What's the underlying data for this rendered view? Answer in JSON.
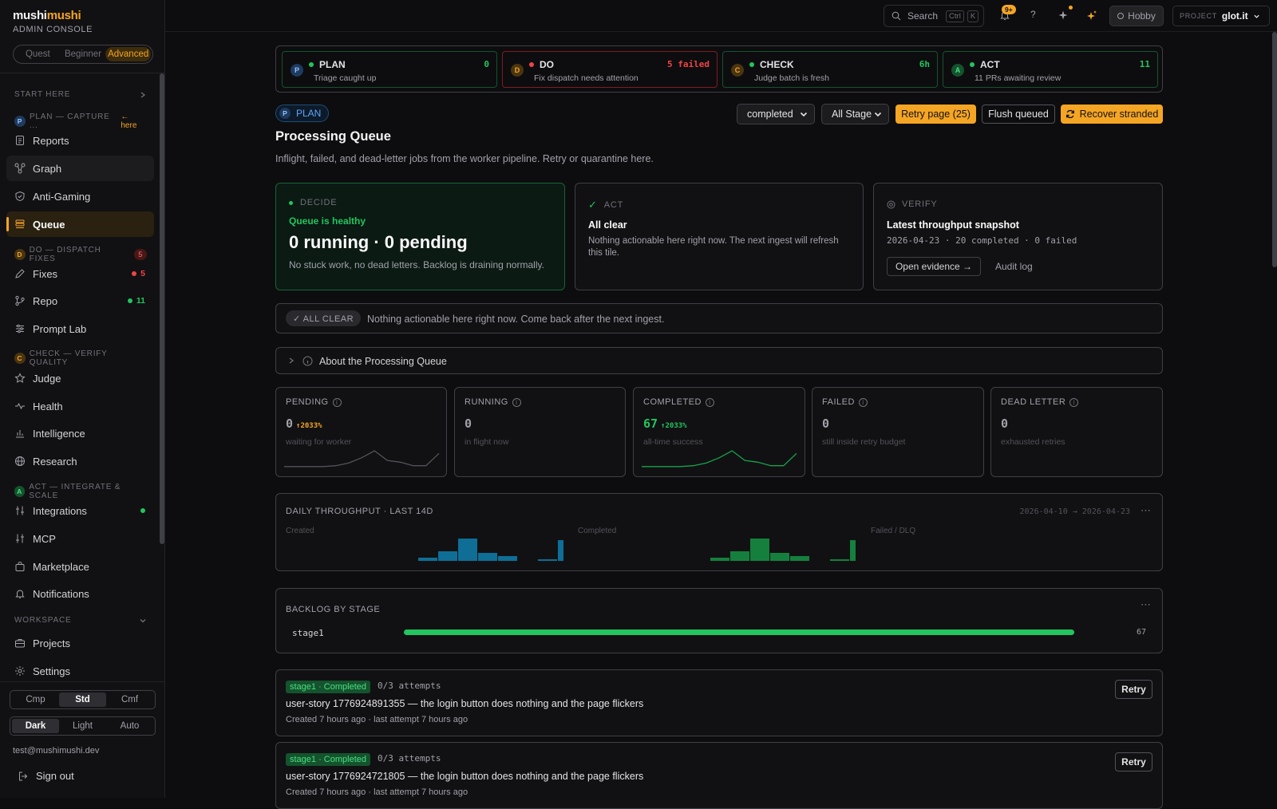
{
  "brand": {
    "prefix": "mushi",
    "accent": "mushi",
    "subtitle": "ADMIN CONSOLE"
  },
  "modes": [
    {
      "label": "Quest",
      "active": false
    },
    {
      "label": "Beginner",
      "active": false
    },
    {
      "label": "Advanced",
      "active": true
    }
  ],
  "sidebar": {
    "start_here": "START HERE",
    "plan_section": {
      "badge": "P",
      "label": "PLAN — CAPTURE ...",
      "here": "← here"
    },
    "do_section": {
      "badge": "D",
      "label": "DO — DISPATCH FIXES",
      "count": "5"
    },
    "check_section": {
      "badge": "C",
      "label": "CHECK — VERIFY QUALITY"
    },
    "act_section": {
      "badge": "A",
      "label": "ACT — INTEGRATE & SCALE"
    },
    "workspace": "WORKSPACE",
    "items": {
      "reports": "Reports",
      "graph": "Graph",
      "anti_gaming": "Anti-Gaming",
      "queue": "Queue",
      "fixes": "Fixes",
      "fixes_count": "5",
      "repo": "Repo",
      "repo_count": "11",
      "prompt_lab": "Prompt Lab",
      "judge": "Judge",
      "health": "Health",
      "intelligence": "Intelligence",
      "research": "Research",
      "integrations": "Integrations",
      "mcp": "MCP",
      "marketplace": "Marketplace",
      "notifications": "Notifications",
      "projects": "Projects",
      "settings": "Settings"
    },
    "density": [
      "Cmp",
      "Std",
      "Cmf"
    ],
    "theme": [
      "Dark",
      "Light",
      "Auto"
    ],
    "email": "test@mushimushi.dev",
    "sign_out": "Sign out"
  },
  "topbar": {
    "search": "Search",
    "kbd_ctrl": "Ctrl",
    "kbd_k": "K",
    "notif_badge": "9+",
    "help": "?",
    "plan": "Hobby",
    "project_label": "PROJECT",
    "project_value": "glot.it"
  },
  "pdca": [
    {
      "badge": "P",
      "title": "PLAN",
      "sub": "Triage caught up",
      "metric": "0",
      "status": "ok"
    },
    {
      "badge": "D",
      "title": "DO",
      "sub": "Fix dispatch needs attention",
      "metric": "5 failed",
      "status": "fail"
    },
    {
      "badge": "C",
      "title": "CHECK",
      "sub": "Judge batch is fresh",
      "metric": "6h",
      "status": "ok"
    },
    {
      "badge": "A",
      "title": "ACT",
      "sub": "11 PRs awaiting review",
      "metric": "11",
      "status": "ok"
    }
  ],
  "stage_pill": {
    "badge": "P",
    "label": "PLAN"
  },
  "filters": {
    "status": "completed",
    "stage": "All Stage"
  },
  "actions": {
    "retry_page": "Retry page (25)",
    "flush": "Flush queued",
    "recover": "Recover stranded"
  },
  "page": {
    "title": "Processing Queue",
    "description": "Inflight, failed, and dead-letter jobs from the worker pipeline. Retry or quarantine here."
  },
  "decide": {
    "eyebrow": "DECIDE",
    "status": "Queue is healthy",
    "headline": "0 running · 0 pending",
    "detail": "No stuck work, no dead letters. Backlog is draining normally."
  },
  "act": {
    "eyebrow": "ACT",
    "title": "All clear",
    "detail": "Nothing actionable here right now. The next ingest will refresh this tile."
  },
  "verify": {
    "eyebrow": "VERIFY",
    "title": "Latest throughput snapshot",
    "detail": "2026-04-23 · 20 completed · 0 failed",
    "evidence": "Open evidence →",
    "audit": "Audit log"
  },
  "all_clear": {
    "pill": "✓ ALL CLEAR",
    "text": "Nothing actionable here right now. Come back after the next ingest."
  },
  "about": "About the Processing Queue",
  "stats": [
    {
      "label": "PENDING",
      "value": "0",
      "delta": "↑2033%",
      "sub": "waiting for worker",
      "spark": [
        2,
        2,
        2,
        2,
        3,
        6,
        12,
        20,
        9,
        7,
        3,
        3,
        17
      ],
      "color": "#52525b"
    },
    {
      "label": "RUNNING",
      "value": "0",
      "delta": "",
      "sub": "in flight now"
    },
    {
      "label": "COMPLETED",
      "value": "67",
      "delta": "↑2033%",
      "sub": "all-time success",
      "spark": [
        2,
        2,
        2,
        2,
        3,
        6,
        12,
        20,
        9,
        7,
        3,
        3,
        17
      ],
      "color": "#16a34a"
    },
    {
      "label": "FAILED",
      "value": "0",
      "delta": "",
      "sub": "still inside retry budget"
    },
    {
      "label": "DEAD LETTER",
      "value": "0",
      "delta": "",
      "sub": "exhausted retries"
    }
  ],
  "throughput": {
    "title": "DAILY THROUGHPUT · LAST 14D",
    "range": "2026-04-10 → 2026-04-23",
    "panels": [
      "Created",
      "Completed",
      "Failed / DLQ"
    ],
    "created": [
      0,
      0,
      0,
      0,
      0,
      0,
      0,
      2,
      6,
      14,
      5,
      3,
      0,
      1,
      13
    ],
    "completed": [
      0,
      0,
      0,
      0,
      0,
      0,
      0,
      2,
      6,
      14,
      5,
      3,
      0,
      1,
      13
    ],
    "failed": []
  },
  "backlog": {
    "title": "BACKLOG BY STAGE",
    "rows": [
      {
        "stage": "stage1",
        "count": "67",
        "fraction": 1
      }
    ]
  },
  "jobs": [
    {
      "tag": "stage1 · Completed",
      "attempts": "0/3 attempts",
      "title": "user-story 1776924891355 — the login button does nothing and the page flickers",
      "meta": "Created 7 hours ago · last attempt 7 hours ago",
      "retry": "Retry"
    },
    {
      "tag": "stage1 · Completed",
      "attempts": "0/3 attempts",
      "title": "user-story 1776924721805 — the login button does nothing and the page flickers",
      "meta": "Created 7 hours ago · last attempt 7 hours ago",
      "retry": "Retry"
    }
  ],
  "colors": {
    "accent": "#f5a524",
    "success": "#22c55e",
    "danger": "#ef4444",
    "blue": "#0e7490"
  }
}
